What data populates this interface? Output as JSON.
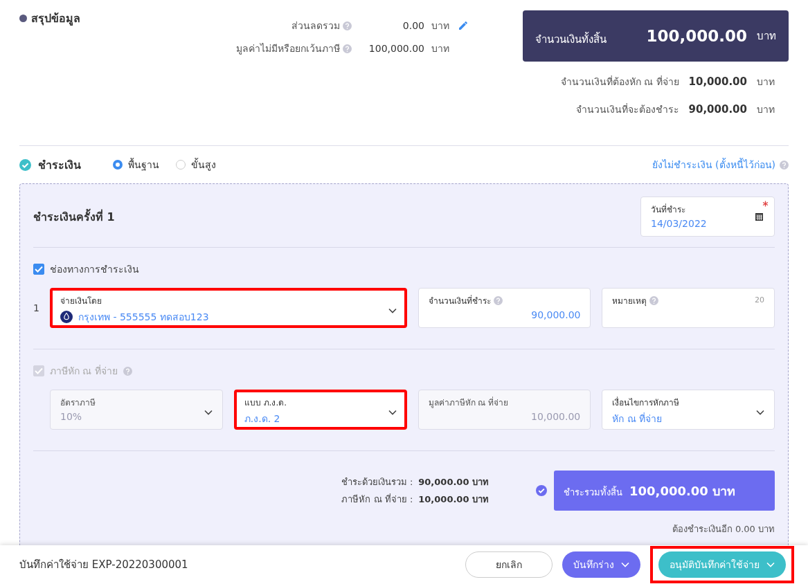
{
  "summary": {
    "title": "สรุปข้อมูล",
    "rows": [
      {
        "label": "ส่วนลดรวม",
        "value": "0.00",
        "unit": "บาท",
        "editable": true
      },
      {
        "label": "มูลค่าไม่มีหรือยกเว้นภาษี",
        "value": "100,000.00",
        "unit": "บาท",
        "editable": false
      }
    ],
    "total": {
      "label": "จำนวนเงินทั้งสิ้น",
      "value": "100,000.00",
      "unit": "บาท"
    },
    "extra_rows": [
      {
        "label": "จำนวนเงินที่ต้องหัก ณ ที่จ่าย",
        "value": "10,000.00",
        "unit": "บาท"
      },
      {
        "label": "จำนวนเงินที่จะต้องชำระ",
        "value": "90,000.00",
        "unit": "บาท"
      }
    ]
  },
  "payment": {
    "title": "ชำระเงิน",
    "checked": true,
    "modes": [
      {
        "label": "พื้นฐาน",
        "selected": true
      },
      {
        "label": "ขั้นสูง",
        "selected": false
      }
    ],
    "defer_link": "ยังไม่ชำระเงิน (ตั้งหนี้ไว้ก่อน)"
  },
  "panel": {
    "title": "ชำระเงินครั้งที่ 1",
    "date_field": {
      "label": "วันที่ชำระ",
      "value": "14/03/2022",
      "required": true
    },
    "channel_section": {
      "label": "ช่องทางการชำระเงิน",
      "checked": true,
      "disabled": false,
      "rows": [
        {
          "index": "1",
          "method": {
            "label": "จ่ายเงินโดย",
            "value": "กรุงเทพ - 555555 ทดสอบ123",
            "highlighted": true
          },
          "amount": {
            "label": "จำนวนเงินที่ชำระ",
            "value": "90,000.00"
          },
          "note": {
            "label": "หมายเหตุ",
            "counter": "20"
          }
        }
      ]
    },
    "tax_section": {
      "label": "ภาษีหัก ณ ที่จ่าย",
      "checked": true,
      "disabled": true,
      "fields": [
        {
          "kind": "select",
          "label": "อัตราภาษี",
          "value": "10%",
          "disabled": true,
          "highlighted": false
        },
        {
          "kind": "select",
          "label": "แบบ ภ.ง.ด.",
          "value": "ภ.ง.ด. 2",
          "disabled": false,
          "highlighted": true
        },
        {
          "kind": "readonly",
          "label": "มูลค่าภาษีหัก ณ ที่จ่าย",
          "value": "10,000.00",
          "disabled": true,
          "highlighted": false
        },
        {
          "kind": "select",
          "label": "เงื่อนไขการหักภาษี",
          "value": "หัก ณ ที่จ่าย",
          "disabled": false,
          "highlighted": false
        }
      ]
    },
    "totals": [
      {
        "label": "ชำระด้วยเงินรวม :",
        "value": "90,000.00 บาท"
      },
      {
        "label": "ภาษีหัก ณ ที่จ่าย :",
        "value": "10,000.00 บาท"
      }
    ],
    "grand": {
      "label": "ชำระรวมทั้งสิ้น",
      "value": "100,000.00 บาท",
      "confirmed": true
    },
    "remaining": "ต้องชำระเงินอีก 0.00 บาท"
  },
  "footer": {
    "title": "บันทึกค่าใช้จ่าย EXP-20220300001",
    "buttons": [
      {
        "kind": "outline",
        "label": "ยกเลิก",
        "dropdown": false,
        "highlighted": false
      },
      {
        "kind": "secondary",
        "label": "บันทึกร่าง",
        "dropdown": true,
        "highlighted": false
      },
      {
        "kind": "primary",
        "label": "อนุมัติบันทึกค่าใช้จ่าย",
        "dropdown": true,
        "highlighted": true
      }
    ]
  }
}
